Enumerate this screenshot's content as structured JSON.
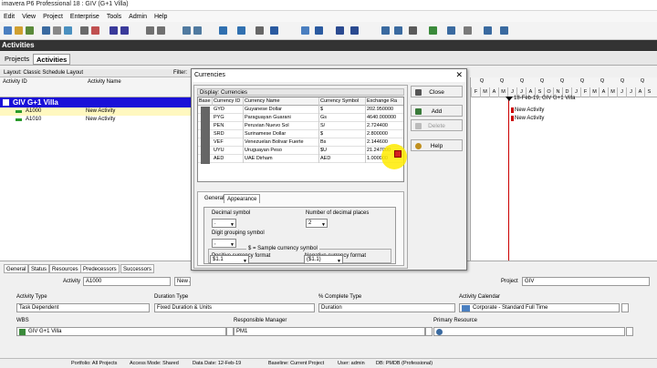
{
  "window": {
    "title": "imavera P6 Professional 18 : GIV (G+1 Villa)"
  },
  "menu": [
    "Edit",
    "View",
    "Project",
    "Enterprise",
    "Tools",
    "Admin",
    "Help"
  ],
  "activities_header": "Activities",
  "tabs": [
    "Projects",
    "Activities"
  ],
  "layout_label": "Layout: Classic Schedule Layout",
  "filter_label": "Filter:",
  "columns": {
    "activity_id": "Activity ID",
    "activity_name": "Activity Name"
  },
  "project_row": "GIV  G+1 Villa",
  "activities": [
    {
      "id": "A1000",
      "name": "New Activity"
    },
    {
      "id": "A1010",
      "name": "New Activity"
    }
  ],
  "gantt": {
    "quarters": [
      "Q",
      "Q",
      "Q",
      "Q",
      "Q",
      "Q",
      "Q",
      "Q",
      "Q"
    ],
    "months": [
      "F",
      "M",
      "A",
      "M",
      "J",
      "J",
      "A",
      "S",
      "O",
      "N",
      "D",
      "J",
      "F",
      "M",
      "A",
      "M",
      "J",
      "J",
      "A",
      "S"
    ],
    "milestone": "18-Feb-19, GIV  G+1 Villa",
    "labels": [
      "New Activity",
      "New Activity"
    ]
  },
  "dialog": {
    "title": "Currencies",
    "display_label": "Display: Currencies",
    "columns": [
      "Base",
      "Currency ID",
      "Currency Name",
      "Currency Symbol",
      "Exchange Ra"
    ],
    "rows": [
      {
        "id": "GYD",
        "name": "Guyanese Dollar",
        "symbol": "$",
        "rate": "202.950000"
      },
      {
        "id": "PYG",
        "name": "Paraguayan Guarani",
        "symbol": "Gs",
        "rate": "4640.000000"
      },
      {
        "id": "PEN",
        "name": "Peruvian Nuevo Sol",
        "symbol": "S/",
        "rate": "2.724400"
      },
      {
        "id": "SRD",
        "name": "Surinamese Dollar",
        "symbol": "$",
        "rate": "2.800000"
      },
      {
        "id": "VEF",
        "name": "Venezuelan Bolivar Fuerte",
        "symbol": "Bs",
        "rate": "2.144600"
      },
      {
        "id": "UYU",
        "name": "Uruguayan Peso",
        "symbol": "$U",
        "rate": "21.247000"
      },
      {
        "id": "AED",
        "name": "UAE Dirham",
        "symbol": "AED",
        "rate": "1.000000"
      }
    ],
    "tabs": [
      "General",
      "Appearance"
    ],
    "decimal_symbol_label": "Decimal symbol",
    "decimal_symbol_value": ".",
    "decimal_places_label": "Number of decimal places",
    "decimal_places_value": "2",
    "digit_grouping_label": "Digit grouping symbol",
    "digit_grouping_value": ",",
    "sample_label": "$ = Sample currency symbol",
    "positive_label": "Positive currency format",
    "positive_value": "$1.1",
    "negative_label": "Negative currency format",
    "negative_value": "($1.1)",
    "buttons": {
      "close": "Close",
      "add": "Add",
      "delete": "Delete",
      "help": "Help"
    }
  },
  "bottom": {
    "tabs": [
      "General",
      "Status",
      "Resources",
      "Predecessors",
      "Successors"
    ],
    "activity_label": "Activity",
    "activity_value": "A1000",
    "activity_name_partial": "New A",
    "project_label": "Project",
    "project_value": "GIV",
    "activity_type_label": "Activity Type",
    "activity_type_value": "Task Dependent",
    "duration_type_label": "Duration Type",
    "duration_type_value": "Fixed Duration & Units",
    "percent_type_label": "% Complete Type",
    "percent_type_value": "Duration",
    "calendar_label": "Activity Calendar",
    "calendar_value": "Corporate - Standard Full Time",
    "wbs_label": "WBS",
    "wbs_value": "GIV  G+1 Villa",
    "manager_label": "Responsible Manager",
    "manager_value": "PM1",
    "resource_label": "Primary Resource",
    "resource_value": ""
  },
  "status": {
    "portfolio": "Portfolio: All Projects",
    "access": "Access Mode: Shared",
    "data_date": "Data Date: 12-Feb-19",
    "baseline": "Baseline: Current Project",
    "user": "User: admin",
    "db": "DB: PMDB (Professional)"
  },
  "colors": {
    "project_row": "#1a10d8",
    "activity_bar": "#2a9a2a",
    "highlight": "#ffeb00",
    "milestone": "#c00000"
  }
}
